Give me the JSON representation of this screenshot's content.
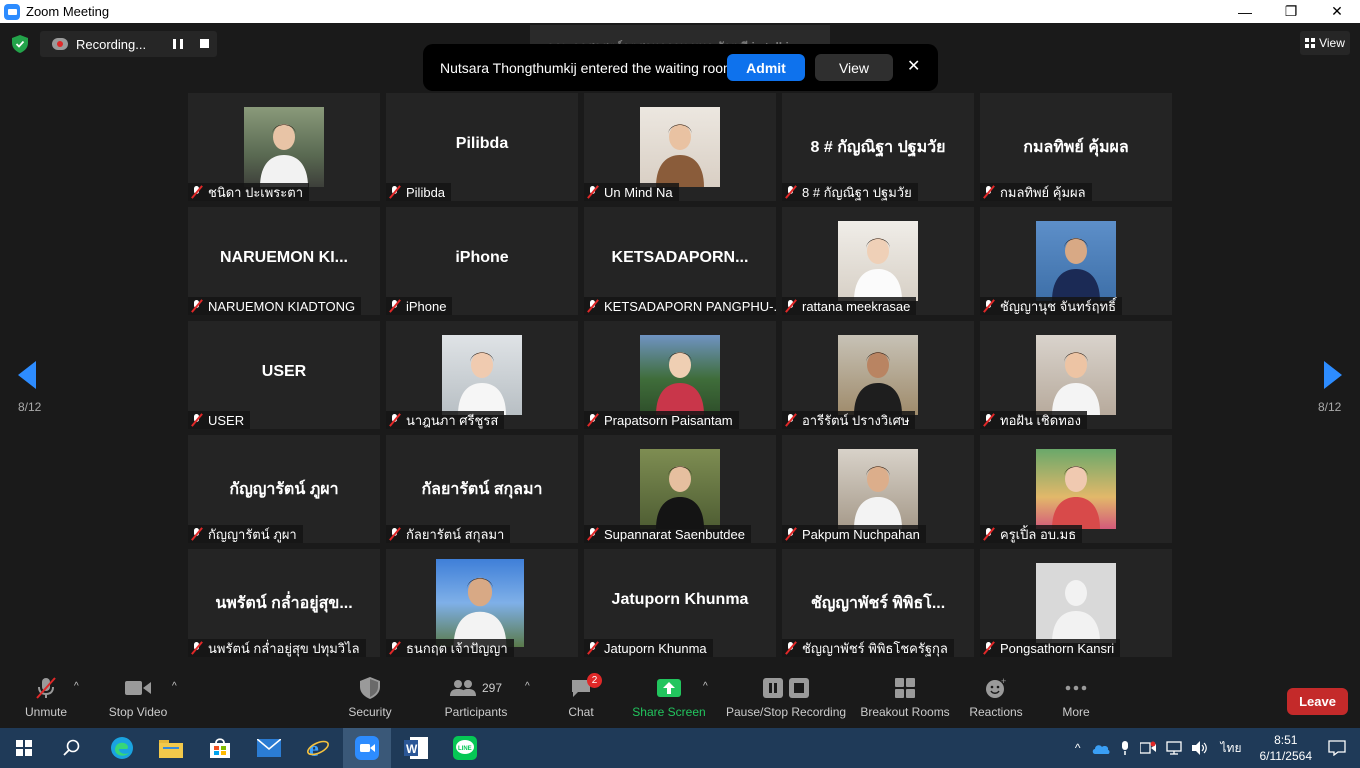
{
  "window": {
    "title": "Zoom Meeting",
    "minimize": "—",
    "maximize": "❐",
    "close": "✕"
  },
  "recording": {
    "label": "Recording..."
  },
  "talking": {
    "text": "คณะครุศาสตร์อุตสาหกรรม มทร.ธัญบุรี is talking..."
  },
  "view": {
    "label": "View"
  },
  "waiting_notice": {
    "message": "Nutsara Thongthumkij entered the waiting room",
    "admit": "Admit",
    "view": "View",
    "close": "✕"
  },
  "pagination": {
    "left": "8/12",
    "right": "8/12"
  },
  "tiles": [
    {
      "big": "",
      "name": "ชนิดา ปะเพระตา",
      "photo": "p1"
    },
    {
      "big": "Pilibda",
      "name": "Pilibda",
      "photo": ""
    },
    {
      "big": "",
      "name": "Un Mind Na",
      "photo": "p3"
    },
    {
      "big": "8 # กัญณิฐา ปฐมวัย",
      "name": "8 # กัญณิฐา ปฐมวัย",
      "photo": ""
    },
    {
      "big": "กมลทิพย์ คุ้มผล",
      "name": "กมลทิพย์ คุ้มผล",
      "photo": ""
    },
    {
      "big": "NARUEMON  KI...",
      "name": "NARUEMON  KIADTONG",
      "photo": ""
    },
    {
      "big": "iPhone",
      "name": "iPhone",
      "photo": ""
    },
    {
      "big": "KETSADAPORN...",
      "name": "KETSADAPORN PANGPHU-...",
      "photo": ""
    },
    {
      "big": "",
      "name": "rattana meekrasae",
      "photo": "p9"
    },
    {
      "big": "",
      "name": "ชัญญานุช จันทร์ฤทธิ์",
      "photo": "p10"
    },
    {
      "big": "USER",
      "name": "USER",
      "photo": ""
    },
    {
      "big": "",
      "name": "นาฎนภา  ศรีชูรส",
      "photo": "p12"
    },
    {
      "big": "",
      "name": "Prapatsorn Paisantam",
      "photo": "p13"
    },
    {
      "big": "",
      "name": "อารีรัตน์ ปรางวิเศษ",
      "photo": "p14"
    },
    {
      "big": "",
      "name": "ทอฝัน เชิดทอง",
      "photo": "p15"
    },
    {
      "big": "กัญญารัตน์ ภูผา",
      "name": "กัญญารัตน์ ภูผา",
      "photo": ""
    },
    {
      "big": "กัลยารัตน์ สกุลมา",
      "name": "กัลยารัตน์ สกุลมา",
      "photo": ""
    },
    {
      "big": "",
      "name": "Supannarat Saenbutdee",
      "photo": "p18"
    },
    {
      "big": "",
      "name": "Pakpum Nuchpahan",
      "photo": "p19"
    },
    {
      "big": "",
      "name": "ครูเปิ้ล อบ.มธ",
      "photo": "p20"
    },
    {
      "big": "นพรัตน์ กล่ำอยู่สุข...",
      "name": "นพรัตน์ กล่ำอยู่สุข ปทุมวิไล",
      "photo": ""
    },
    {
      "big": "",
      "name": "ธนกฤต เจ้าปัญญา",
      "photo": "p22"
    },
    {
      "big": "Jatuporn Khunma",
      "name": "Jatuporn Khunma",
      "photo": ""
    },
    {
      "big": "ชัญญาพัชร์ พิพิธโ...",
      "name": "ชัญญาพัชร์ พิพิธโชครัฐกุล",
      "photo": ""
    },
    {
      "big": "",
      "name": "Pongsathorn Kansri",
      "photo": "p25"
    }
  ],
  "toolbar": {
    "unmute": "Unmute",
    "stop_video": "Stop Video",
    "security": "Security",
    "participants": "Participants",
    "participants_count": "297",
    "chat": "Chat",
    "chat_badge": "2",
    "share_screen": "Share Screen",
    "pause_stop_recording": "Pause/Stop Recording",
    "breakout_rooms": "Breakout Rooms",
    "reactions": "Reactions",
    "more": "More",
    "leave": "Leave"
  },
  "taskbar": {
    "language": "ไทย",
    "time": "8:51",
    "date": "6/11/2564"
  },
  "colors": {
    "accent": "#0e72ed",
    "share_green": "#22c55e",
    "leave_red": "#c42a2a",
    "taskbar": "#1f3a58"
  }
}
